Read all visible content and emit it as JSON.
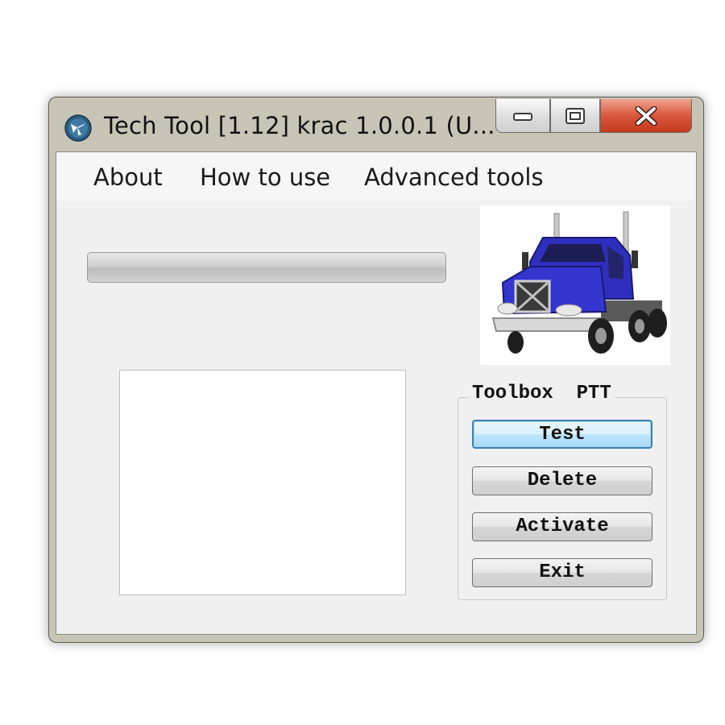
{
  "window": {
    "title": "Tech Tool [1.12]  krac 1.0.0.1   (U..."
  },
  "menu": {
    "items": [
      "About",
      "How to use",
      "Advanced tools"
    ]
  },
  "progress": {
    "value": 0
  },
  "image": {
    "icon_name": "truck-image"
  },
  "group": {
    "label": "Toolbox  PTT",
    "buttons": [
      "Test",
      "Delete",
      "Activate",
      "Exit"
    ]
  },
  "colors": {
    "truck_body": "#2f2fbf",
    "close_button": "#d9573d",
    "focus_border": "#3c7fb1"
  }
}
